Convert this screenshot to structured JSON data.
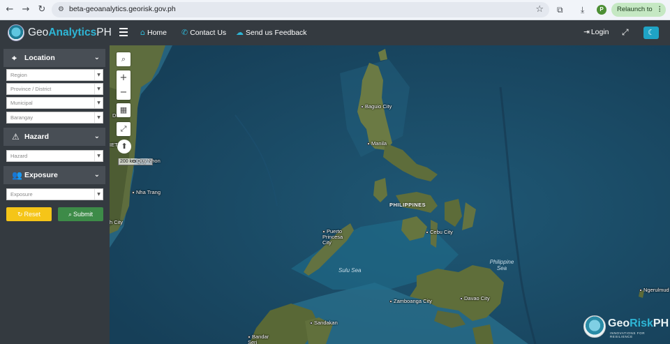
{
  "browser": {
    "url": "beta-geoanalytics.georisk.gov.ph",
    "profile_initial": "P",
    "relaunch_label": "Relaunch to update"
  },
  "header": {
    "brand_prefix": "Geo",
    "brand_main": "Analytics",
    "brand_suffix": "PH",
    "nav": [
      {
        "label": "Home",
        "icon": "home-icon"
      },
      {
        "label": "Contact Us",
        "icon": "phone-icon"
      },
      {
        "label": "Send us Feedback",
        "icon": "chat-icon"
      }
    ],
    "login_label": "Login",
    "accent_color": "#2eb6d6"
  },
  "sidebar": {
    "location": {
      "title": "Location",
      "selects": [
        "Region",
        "Province / District",
        "Municipal",
        "Barangay"
      ]
    },
    "hazard": {
      "title": "Hazard",
      "selects": [
        "Hazard"
      ]
    },
    "exposure": {
      "title": "Exposure",
      "selects": [
        "Exposure"
      ]
    },
    "reset_label": "Reset",
    "submit_label": "Submit"
  },
  "map": {
    "scale_label": "200 km",
    "cities": [
      "Baguio City",
      "Manila",
      "Puerto Princesa City",
      "Cebu City",
      "Zamboanga City",
      "Davao City",
      "Sandakan",
      "Bandar Seri Begawan",
      "Nha Trang",
      "Quy Nhon",
      "Ngerulmud"
    ],
    "country_label": "PHILIPPINES",
    "sea_labels": [
      "Sulu Sea",
      "Philippine Sea"
    ],
    "partial_labels": [
      "D",
      "IET",
      "h City"
    ],
    "logo": {
      "prefix": "Geo",
      "main": "Risk",
      "suffix": "PH",
      "tagline": "INNOVATIONS FOR RESILIENCE"
    }
  }
}
